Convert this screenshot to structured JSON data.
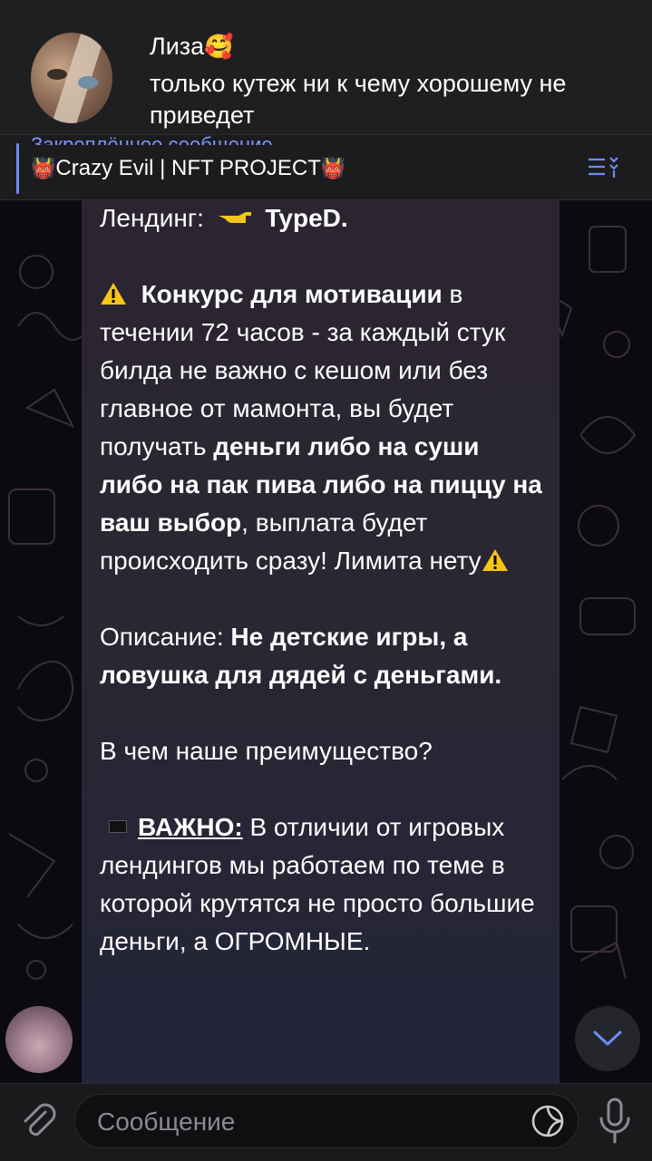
{
  "notification": {
    "name": "Лиза",
    "emoji": "🥰",
    "text": "только кутеж ни к чему хорошему не приведет"
  },
  "pinned": {
    "title": "Закреплённое сообщение",
    "subtitle": "Crazy Evil | NFT PROJECT",
    "devil_emoji": "👹"
  },
  "message": {
    "landing_label": "Лендинг:",
    "landing_value": "TypeD.",
    "contest_bold": "Конкурс для мотивации",
    "contest_text1": " в течении 72 часов - за каждый стук билда не важно с кешом или без главное от мамонта, вы будет получать ",
    "contest_bold2": "деньги либо на суши либо на пак пива либо на пиццу на ваш выбор",
    "contest_text2": ", выплата будет происходить сразу! Лимита нету",
    "desc_label": "Описание: ",
    "desc_bold": "Не детские игры, а ловушка для дядей с деньгами.",
    "advantage_question": "В чем наше преимущество?",
    "important_label": "ВАЖНО:",
    "important_text": " В отличии от игровых лендингов мы работаем по теме в которой крутятся не просто большие деньги, а ОГРОМНЫЕ."
  },
  "input": {
    "placeholder": "Сообщение"
  },
  "colors": {
    "accent": "#7a96ff",
    "warning": "#f5c518",
    "bubble": "#2a2633",
    "input_bg": "#0f0f12"
  },
  "icons": [
    "attach-icon",
    "sticker-icon",
    "mic-icon",
    "chevron-down-icon",
    "pinned-list-icon",
    "warning-icon",
    "pointing-hand-icon"
  ]
}
